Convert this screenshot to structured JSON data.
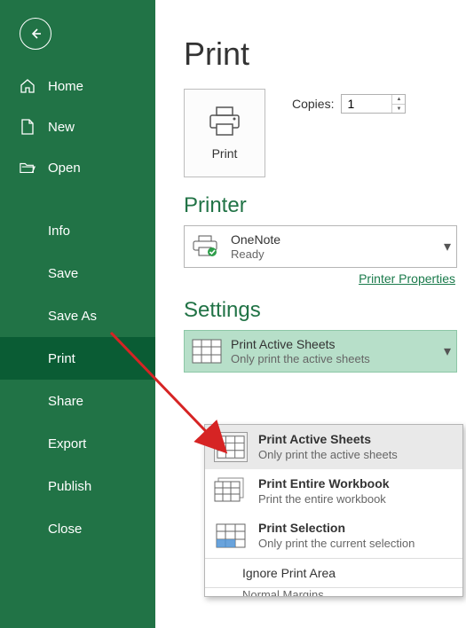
{
  "sidebar": {
    "home": "Home",
    "new": "New",
    "open": "Open",
    "items": [
      "Info",
      "Save",
      "Save As",
      "Print",
      "Share",
      "Export",
      "Publish",
      "Close"
    ],
    "active_index": 3
  },
  "page_title": "Print",
  "print_button_label": "Print",
  "copies": {
    "label": "Copies:",
    "value": "1"
  },
  "printer": {
    "section_title": "Printer",
    "name": "OneNote",
    "status": "Ready",
    "properties_link": "Printer Properties"
  },
  "settings": {
    "section_title": "Settings",
    "selected": {
      "title": "Print Active Sheets",
      "subtitle": "Only print the active sheets"
    },
    "options": [
      {
        "title": "Print Active Sheets",
        "subtitle": "Only print the active sheets"
      },
      {
        "title": "Print Entire Workbook",
        "subtitle": "Print the entire workbook"
      },
      {
        "title": "Print Selection",
        "subtitle": "Only print the current selection"
      }
    ],
    "ignore_label": "Ignore Print Area",
    "margins_cut": "Normal Margins"
  }
}
